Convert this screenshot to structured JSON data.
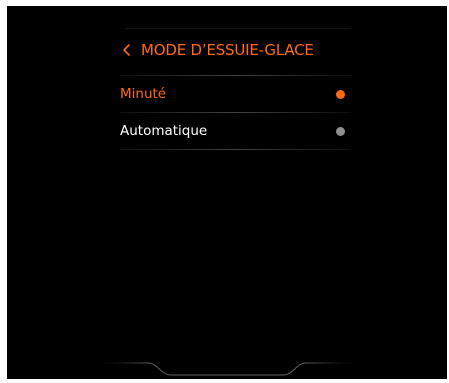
{
  "screen": {
    "title": "MODE D’ESSUIE-GLACE",
    "back_icon": "chevron-left-icon",
    "accent_color": "#ff6a12",
    "options": [
      {
        "label": "Minuté",
        "selected": true,
        "label_color": "#ff6a12",
        "dot_color": "#ff6a12"
      },
      {
        "label": "Automatique",
        "selected": false,
        "label_color": "#ffffff",
        "dot_color": "#8e8e8e"
      }
    ]
  }
}
